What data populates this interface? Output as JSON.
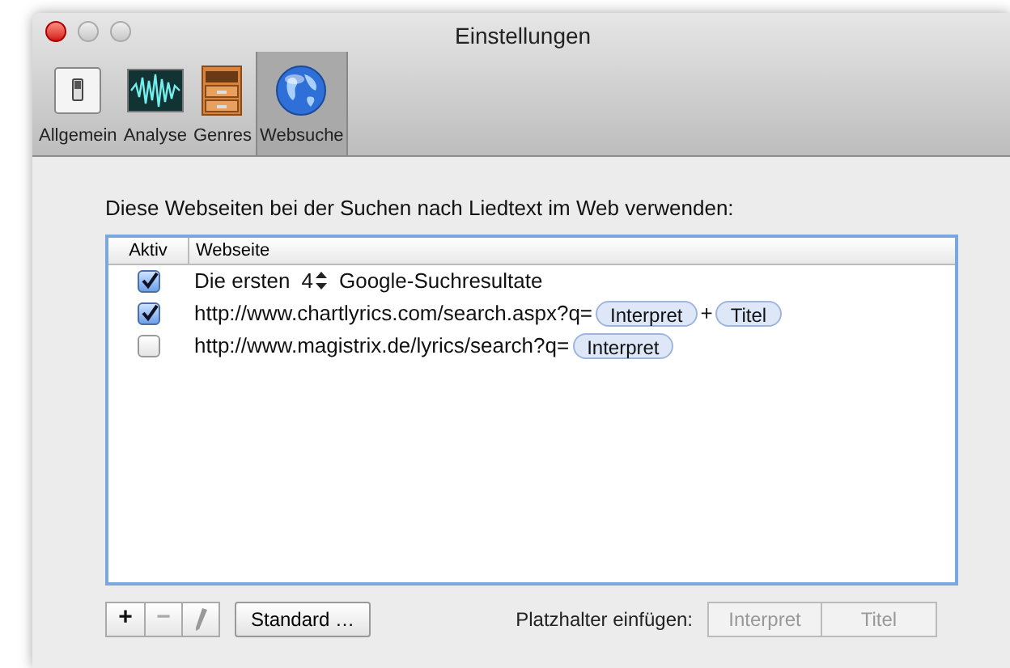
{
  "window": {
    "title": "Einstellungen"
  },
  "toolbar": [
    {
      "label": "Allgemein",
      "kind": "switch",
      "selected": false
    },
    {
      "label": "Analyse",
      "kind": "wave",
      "selected": false
    },
    {
      "label": "Genres",
      "kind": "drawers",
      "selected": false
    },
    {
      "label": "Websuche",
      "kind": "globe",
      "selected": true
    }
  ],
  "intro": "Diese Webseiten bei der Suchen nach Liedtext im Web verwenden:",
  "table": {
    "columns": [
      "Aktiv",
      "Webseite"
    ],
    "rows": [
      {
        "checked": true,
        "segments": [
          {
            "kind": "text",
            "text": "Die ersten"
          },
          {
            "kind": "stepper",
            "text": "4"
          },
          {
            "kind": "text",
            "text": "Google-Suchresultate"
          }
        ]
      },
      {
        "checked": true,
        "segments": [
          {
            "kind": "text",
            "text": "http://www.chartlyrics.com/search.aspx?q="
          },
          {
            "kind": "token",
            "text": "Interpret"
          },
          {
            "kind": "text",
            "text": "+"
          },
          {
            "kind": "token",
            "text": "Titel"
          }
        ]
      },
      {
        "checked": false,
        "segments": [
          {
            "kind": "text",
            "text": "http://www.magistrix.de/lyrics/search?q="
          },
          {
            "kind": "token",
            "text": "Interpret"
          }
        ]
      }
    ]
  },
  "buttons": [
    {
      "kind": "add",
      "text": "+",
      "disabled": false
    },
    {
      "kind": "remove",
      "text": "−",
      "disabled": true
    },
    {
      "kind": "edit",
      "disabled": true
    }
  ],
  "standard_button": "Standard …",
  "placeholder_label": "Platzhalter einfügen:",
  "placeholder_buttons": [
    {
      "text": "Interpret",
      "disabled": true
    },
    {
      "text": "Titel",
      "disabled": true
    }
  ]
}
